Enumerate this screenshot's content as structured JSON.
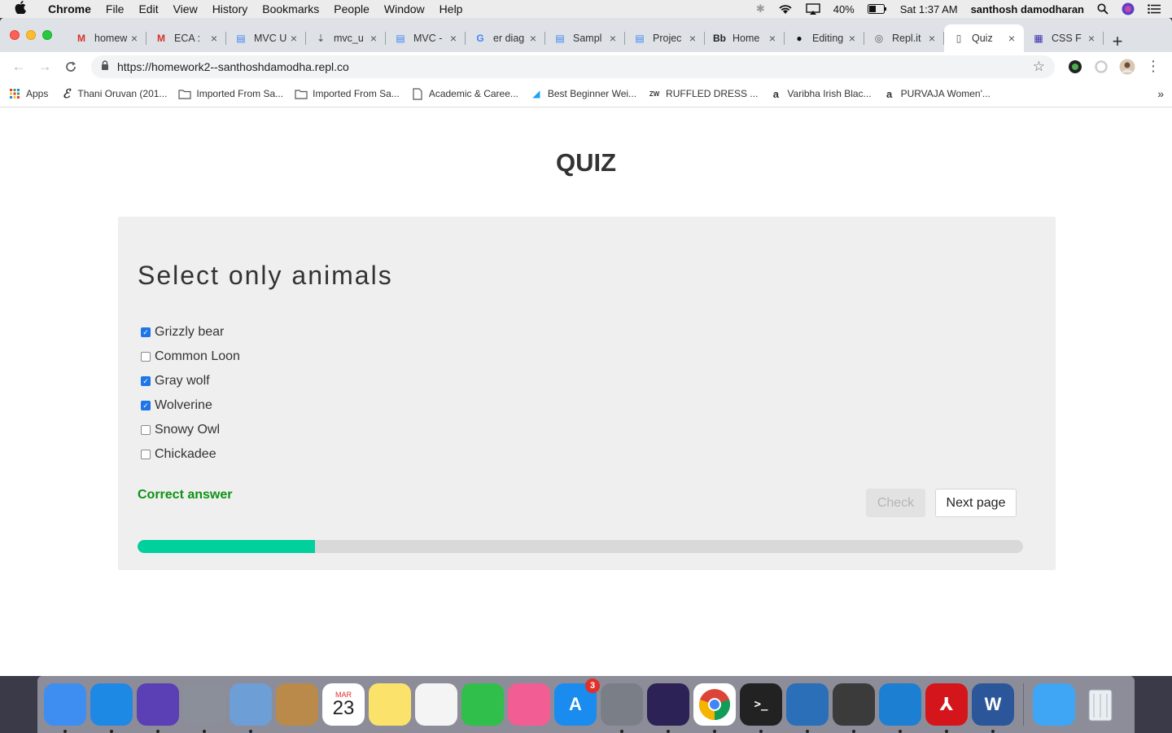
{
  "menubar": {
    "app_name": "Chrome",
    "items": [
      "File",
      "Edit",
      "View",
      "History",
      "Bookmarks",
      "People",
      "Window",
      "Help"
    ],
    "battery": "40%",
    "clock": "Sat 1:37 AM",
    "user": "santhosh damodharan"
  },
  "tabs": [
    {
      "title": "homew",
      "icon": "gmail-icon",
      "color": "#d93025",
      "glyph": "M"
    },
    {
      "title": "ECA :",
      "icon": "gmail-icon",
      "color": "#d93025",
      "glyph": "M"
    },
    {
      "title": "MVC U",
      "icon": "docs-icon",
      "color": "#4285f4",
      "glyph": "▤"
    },
    {
      "title": "mvc_u",
      "icon": "drive-icon",
      "color": "#666666",
      "glyph": "⇣"
    },
    {
      "title": "MVC -",
      "icon": "docs-icon",
      "color": "#4285f4",
      "glyph": "▤"
    },
    {
      "title": "er diag",
      "icon": "google-icon",
      "color": "#4285f4",
      "glyph": "G"
    },
    {
      "title": "Sampl",
      "icon": "docs-icon",
      "color": "#4285f4",
      "glyph": "▤"
    },
    {
      "title": "Projec",
      "icon": "docs-icon",
      "color": "#4285f4",
      "glyph": "▤"
    },
    {
      "title": "Home",
      "icon": "blackboard-icon",
      "color": "#222222",
      "glyph": "Bb"
    },
    {
      "title": "Editing",
      "icon": "github-icon",
      "color": "#111111",
      "glyph": "●"
    },
    {
      "title": "Repl.it",
      "icon": "replit-icon",
      "color": "#555555",
      "glyph": "◎"
    },
    {
      "title": "Quiz",
      "icon": "page-icon",
      "color": "#555555",
      "glyph": "▯",
      "active": true
    },
    {
      "title": "CSS F",
      "icon": "css-icon",
      "color": "#3b2fb0",
      "glyph": "▦"
    }
  ],
  "address_bar": {
    "url": "https://homework2--santhoshdamodha.repl.co"
  },
  "bookmarks": [
    {
      "label": "Apps",
      "icon": "apps-grid-icon"
    },
    {
      "label": "Thani Oruvan (201...",
      "icon": "e-icon"
    },
    {
      "label": "Imported From Sa...",
      "icon": "folder-icon"
    },
    {
      "label": "Imported From Sa...",
      "icon": "folder-icon"
    },
    {
      "label": "Academic & Caree...",
      "icon": "page-icon"
    },
    {
      "label": "Best Beginner Wei...",
      "icon": "bird-icon"
    },
    {
      "label": "RUFFLED DRESS ...",
      "icon": "zara-icon"
    },
    {
      "label": "Varibha Irish Blac...",
      "icon": "amazon-icon"
    },
    {
      "label": "PURVAJA Women'...",
      "icon": "amazon-icon"
    }
  ],
  "quiz": {
    "title": "QUIZ",
    "question": "Select only animals",
    "options": [
      {
        "label": "Grizzly bear",
        "checked": true
      },
      {
        "label": "Common Loon",
        "checked": false
      },
      {
        "label": "Gray wolf",
        "checked": true
      },
      {
        "label": "Wolverine",
        "checked": true
      },
      {
        "label": "Snowy Owl",
        "checked": false
      },
      {
        "label": "Chickadee",
        "checked": false
      }
    ],
    "feedback": "Correct answer",
    "feedback_color": "#0e9215",
    "check_label": "Check",
    "next_label": "Next page",
    "progress_percent": 20,
    "progress_color": "#00d09b"
  },
  "dock": {
    "calendar_month": "MAR",
    "calendar_day": "23",
    "appstore_badge": "3",
    "apps": [
      {
        "name": "finder-icon",
        "color": "#3d8ef0"
      },
      {
        "name": "safari-icon",
        "color": "#1e88e5"
      },
      {
        "name": "siri-icon",
        "color": "#5a3fb5"
      },
      {
        "name": "launchpad-icon",
        "color": "#8a8f99"
      },
      {
        "name": "preview-icon",
        "color": "#6d9ed6"
      },
      {
        "name": "contacts-icon",
        "color": "#b98a4a"
      },
      {
        "name": "calendar-icon",
        "color": "#ffffff"
      },
      {
        "name": "notes-icon",
        "color": "#fbe36b"
      },
      {
        "name": "photos-icon",
        "color": "#f4f4f4"
      },
      {
        "name": "facetime-icon",
        "color": "#2fbf4a"
      },
      {
        "name": "itunes-icon",
        "color": "#f25d94"
      },
      {
        "name": "appstore-icon",
        "color": "#1a8cf0"
      },
      {
        "name": "system-preferences-icon",
        "color": "#7a7f87"
      },
      {
        "name": "eclipse-icon",
        "color": "#2c2255"
      },
      {
        "name": "chrome-icon",
        "color": "#ffffff"
      },
      {
        "name": "terminal-icon",
        "color": "#222222"
      },
      {
        "name": "mamp-icon",
        "color": "#2a6fb7"
      },
      {
        "name": "sublime-icon",
        "color": "#3b3b3b"
      },
      {
        "name": "brackets-icon",
        "color": "#1d7fd1"
      },
      {
        "name": "acrobat-icon",
        "color": "#d4161c"
      },
      {
        "name": "word-icon",
        "color": "#2b579a"
      },
      {
        "name": "messages-icon",
        "color": "#3ea6f4"
      }
    ]
  }
}
